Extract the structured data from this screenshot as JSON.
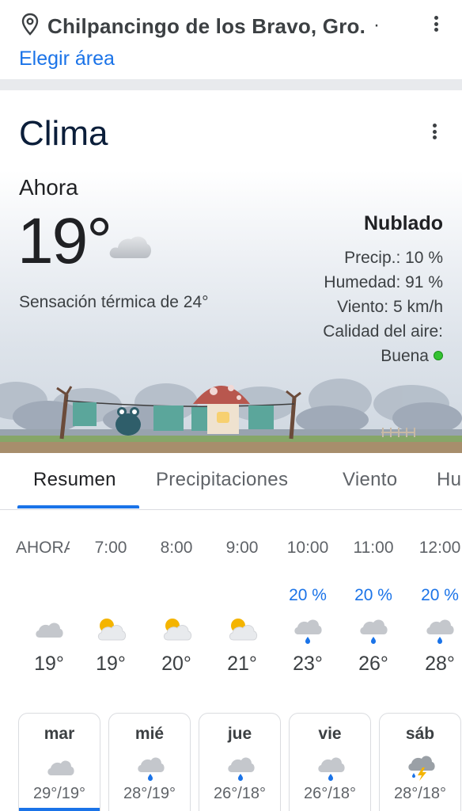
{
  "location": {
    "name": "Chilpancingo de los Bravo, Gro.",
    "separator": "·",
    "change_area": "Elegir área"
  },
  "weather": {
    "title": "Clima",
    "now_label": "Ahora",
    "temperature": "19°",
    "feels_like": "Sensación térmica de 24°",
    "condition": "Nublado",
    "precip": "Precip.: 10 %",
    "humidity": "Humedad: 91 %",
    "wind": "Viento: 5 km/h",
    "air_quality_label": "Calidad del aire:",
    "air_quality_value": "Buena",
    "air_quality_color": "#34c232"
  },
  "tabs": [
    {
      "label": "Resumen",
      "active": true
    },
    {
      "label": "Precipitaciones",
      "active": false
    },
    {
      "label": "Viento",
      "active": false
    },
    {
      "label": "Humedad",
      "active": false
    }
  ],
  "hourly": [
    {
      "time": "AHORA",
      "pct": "",
      "icon": "cloud-icon",
      "temp": "19°"
    },
    {
      "time": "7:00",
      "pct": "",
      "icon": "partly-sunny-icon",
      "temp": "19°"
    },
    {
      "time": "8:00",
      "pct": "",
      "icon": "partly-sunny-icon",
      "temp": "20°"
    },
    {
      "time": "9:00",
      "pct": "",
      "icon": "partly-sunny-icon",
      "temp": "21°"
    },
    {
      "time": "10:00",
      "pct": "20 %",
      "icon": "rain-icon",
      "temp": "23°"
    },
    {
      "time": "11:00",
      "pct": "20 %",
      "icon": "rain-icon",
      "temp": "26°"
    },
    {
      "time": "12:00",
      "pct": "20 %",
      "icon": "rain-icon",
      "temp": "28°"
    }
  ],
  "daily": [
    {
      "day": "mar",
      "icon": "cloud-icon",
      "range": "29°/19°",
      "selected": true
    },
    {
      "day": "mié",
      "icon": "rain-icon",
      "range": "28°/19°",
      "selected": false
    },
    {
      "day": "jue",
      "icon": "rain-icon",
      "range": "26°/18°",
      "selected": false
    },
    {
      "day": "vie",
      "icon": "rain-icon",
      "range": "26°/18°",
      "selected": false
    },
    {
      "day": "sáb",
      "icon": "thunderstorm-icon",
      "range": "28°/18°",
      "selected": false
    }
  ],
  "colors": {
    "accent": "#1a73e8",
    "separator": "#e8eaed"
  }
}
